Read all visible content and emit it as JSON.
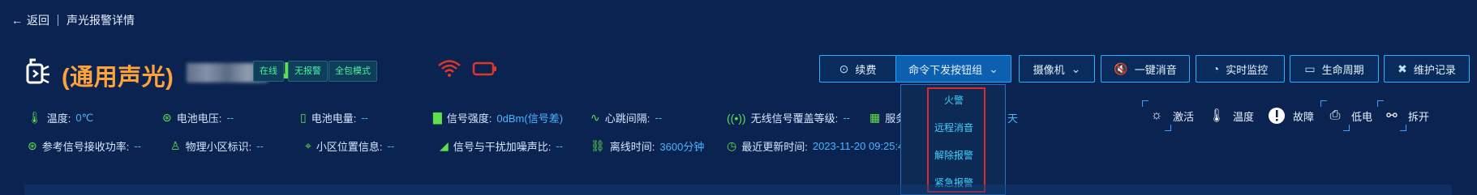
{
  "topbar": {
    "back_label": "返回",
    "page_title": "声光报警详情"
  },
  "device": {
    "title": "(通用声光)",
    "suffix": "NB",
    "badges": [
      "在线",
      "无报警",
      "全包模式"
    ]
  },
  "buttons": {
    "renew": "续费",
    "command": "命令下发按钮组",
    "camera": "摄像机",
    "silence": "一键消音",
    "monitor": "实时监控",
    "lifecycle": "生命周期",
    "maintenance": "维护记录"
  },
  "dropdown": {
    "items": [
      "火警",
      "远程消音",
      "解除报警",
      "紧急报警"
    ]
  },
  "info": {
    "temperature": {
      "label": "温度:",
      "value": "0℃"
    },
    "battery_voltage": {
      "label": "电池电压:",
      "value": "--"
    },
    "battery_level": {
      "label": "电池电量:",
      "value": "--"
    },
    "signal_strength": {
      "label": "信号强度:",
      "value": "0dBm(信号差)"
    },
    "heartbeat": {
      "label": "心跳间隔:",
      "value": "--"
    },
    "coverage": {
      "label": "无线信号覆盖等级:",
      "value": "--"
    },
    "service": {
      "label": "服务",
      "value": "天"
    },
    "rsrp": {
      "label": "参考信号接收功率:",
      "value": "--"
    },
    "cell_id": {
      "label": "物理小区标识:",
      "value": "--"
    },
    "cell_location": {
      "label": "小区位置信息:",
      "value": "--"
    },
    "sinr": {
      "label": "信号与干扰加噪声比:",
      "value": "--"
    },
    "offline_time": {
      "label": "离线时间:",
      "value": "3600分钟"
    },
    "last_update": {
      "label": "最近更新时间:",
      "value": "2023-11-20 09:25:4"
    }
  },
  "status_icons": {
    "activate": "激活",
    "temperature": "温度",
    "fault": "故障",
    "low_power": "低电",
    "dismantle": "拆开"
  },
  "colors": {
    "background": "#0a2350",
    "accent_orange": "#ffa23a",
    "accent_green": "#5ee04b",
    "accent_blue": "#47b6ff",
    "highlight_red": "#e02a2a"
  }
}
